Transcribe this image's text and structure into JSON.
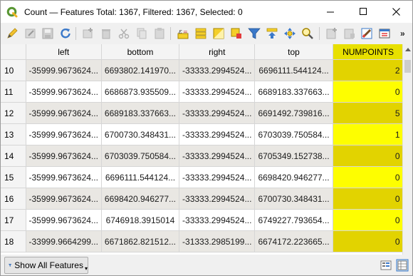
{
  "window": {
    "title": "Count — Features Total: 1367, Filtered: 1367, Selected: 0"
  },
  "toolbar": {
    "icons": [
      "toggle-editing-icon",
      "multi-edit-icon",
      "save-edits-icon",
      "reload-icon",
      "add-feature-icon",
      "delete-feature-icon",
      "cut-icon",
      "copy-icon",
      "paste-icon",
      "expression-select-icon",
      "select-all-icon",
      "invert-selection-icon",
      "deselect-icon",
      "filter-selected-icon",
      "move-selection-top-icon",
      "pan-to-selection-icon",
      "zoom-to-selection-icon",
      "new-field-icon",
      "delete-field-icon",
      "field-calculator-icon",
      "conditional-formatting-icon",
      "more-tools-icon"
    ]
  },
  "table": {
    "columns": [
      "left",
      "bottom",
      "right",
      "top",
      "NUMPOINTS"
    ],
    "rows": [
      {
        "id": "10",
        "left": "-35999.9673624...",
        "bottom": "6693802.141970...",
        "right": "-33333.2994524...",
        "top": "6696111.544124...",
        "numpoints": "2"
      },
      {
        "id": "11",
        "left": "-35999.9673624...",
        "bottom": "6686873.935509...",
        "right": "-33333.2994524...",
        "top": "6689183.337663...",
        "numpoints": "0"
      },
      {
        "id": "12",
        "left": "-35999.9673624...",
        "bottom": "6689183.337663...",
        "right": "-33333.2994524...",
        "top": "6691492.739816...",
        "numpoints": "5"
      },
      {
        "id": "13",
        "left": "-35999.9673624...",
        "bottom": "6700730.348431...",
        "right": "-33333.2994524...",
        "top": "6703039.750584...",
        "numpoints": "1"
      },
      {
        "id": "14",
        "left": "-35999.9673624...",
        "bottom": "6703039.750584...",
        "right": "-33333.2994524...",
        "top": "6705349.152738...",
        "numpoints": "0"
      },
      {
        "id": "15",
        "left": "-35999.9673624...",
        "bottom": "6696111.544124...",
        "right": "-33333.2994524...",
        "top": "6698420.946277...",
        "numpoints": "0"
      },
      {
        "id": "16",
        "left": "-35999.9673624...",
        "bottom": "6698420.946277...",
        "right": "-33333.2994524...",
        "top": "6700730.348431...",
        "numpoints": "0"
      },
      {
        "id": "17",
        "left": "-35999.9673624...",
        "bottom": "6746918.3915014",
        "right": "-33333.2994524...",
        "top": "6749227.793654...",
        "numpoints": "0"
      },
      {
        "id": "18",
        "left": "-33999.9664299...",
        "bottom": "6671862.821512...",
        "right": "-31333.2985199...",
        "top": "6674172.223665...",
        "numpoints": "0"
      }
    ]
  },
  "footer": {
    "show_all_label": "Show All Features"
  },
  "colors": {
    "numpoints_header": "#e8e000",
    "numpoints_cell": "#fefe00",
    "numpoints_cell_alt": "#e2d300"
  }
}
